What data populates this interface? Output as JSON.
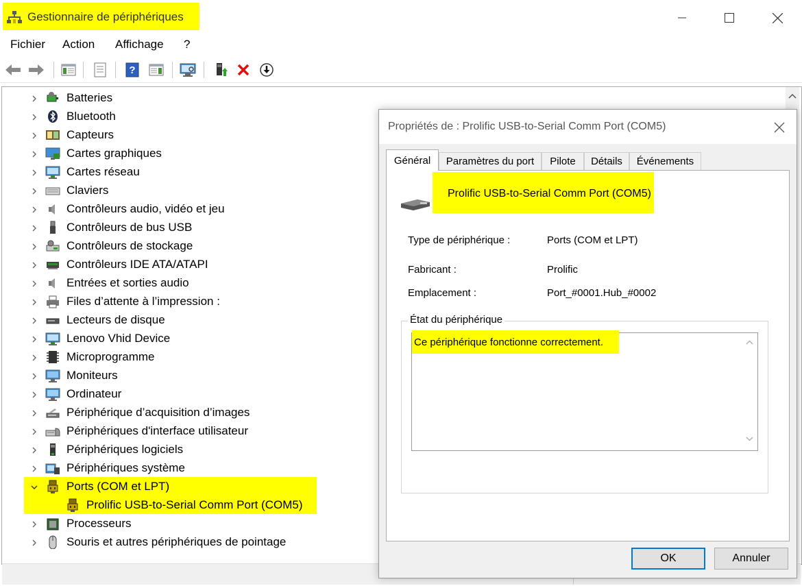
{
  "window": {
    "title": "Gestionnaire de périphériques",
    "controls": {
      "minimize": "—",
      "maximize": "☐",
      "close": "✕"
    }
  },
  "menu": [
    {
      "label": "Fichier"
    },
    {
      "label": "Action"
    },
    {
      "label": "Affichage"
    },
    {
      "label": "?"
    }
  ],
  "toolbar": {
    "icons": [
      "back-arrow-icon",
      "forward-arrow-icon",
      "show-hide-console-tree-icon",
      "properties-sheet-icon",
      "help-icon",
      "action-pane-icon",
      "scan-hardware-icon",
      "update-driver-icon",
      "uninstall-device-icon",
      "disable-device-icon"
    ]
  },
  "tree": {
    "categories": [
      {
        "label": "Batteries",
        "icon": "battery-icon",
        "expanded": false
      },
      {
        "label": "Bluetooth",
        "icon": "bluetooth-icon",
        "expanded": false
      },
      {
        "label": "Capteurs",
        "icon": "sensor-icon",
        "expanded": false
      },
      {
        "label": "Cartes graphiques",
        "icon": "display-adapter-icon",
        "expanded": false
      },
      {
        "label": "Cartes réseau",
        "icon": "network-adapter-icon",
        "expanded": false
      },
      {
        "label": "Claviers",
        "icon": "keyboard-icon",
        "expanded": false
      },
      {
        "label": "Contrôleurs audio, vidéo et jeu",
        "icon": "speaker-icon",
        "expanded": false
      },
      {
        "label": "Contrôleurs de bus USB",
        "icon": "usb-icon",
        "expanded": false
      },
      {
        "label": "Contrôleurs de stockage",
        "icon": "storage-controller-icon",
        "expanded": false
      },
      {
        "label": "Contrôleurs IDE ATA/ATAPI",
        "icon": "ide-controller-icon",
        "expanded": false
      },
      {
        "label": "Entrées et sorties audio",
        "icon": "speaker-icon",
        "expanded": false
      },
      {
        "label": "Files d’attente à l’impression :",
        "icon": "printer-icon",
        "expanded": false
      },
      {
        "label": "Lecteurs de disque",
        "icon": "disk-drive-icon",
        "expanded": false
      },
      {
        "label": "Lenovo Vhid Device",
        "icon": "network-monitor-icon",
        "expanded": false
      },
      {
        "label": "Microprogramme",
        "icon": "firmware-chip-icon",
        "expanded": false
      },
      {
        "label": "Moniteurs",
        "icon": "monitor-icon",
        "expanded": false
      },
      {
        "label": "Ordinateur",
        "icon": "computer-icon",
        "expanded": false
      },
      {
        "label": "Périphérique d’acquisition d’images",
        "icon": "scanner-icon",
        "expanded": false
      },
      {
        "label": "Périphériques d'interface utilisateur",
        "icon": "hid-icon",
        "expanded": false
      },
      {
        "label": "Périphériques logiciels",
        "icon": "software-device-icon",
        "expanded": false
      },
      {
        "label": "Périphériques système",
        "icon": "system-device-icon",
        "expanded": false
      },
      {
        "label": "Ports (COM et LPT)",
        "icon": "port-icon",
        "expanded": true,
        "children": [
          {
            "label": "Prolific USB-to-Serial Comm Port (COM5)",
            "icon": "port-icon"
          }
        ]
      },
      {
        "label": "Processeurs",
        "icon": "processor-icon",
        "expanded": false
      },
      {
        "label": "Souris et autres périphériques de pointage",
        "icon": "mouse-icon",
        "expanded": false
      }
    ]
  },
  "dialog": {
    "title": "Propriétés de : Prolific USB-to-Serial Comm Port (COM5)",
    "tabs": [
      "Général",
      "Paramètres du port",
      "Pilote",
      "Détails",
      "Événements"
    ],
    "active_tab": "Général",
    "device_name": "Prolific USB-to-Serial Comm Port (COM5)",
    "properties": [
      {
        "label": "Type de périphérique :",
        "value": "Ports (COM et LPT)"
      },
      {
        "label": "Fabricant :",
        "value": "Prolific"
      },
      {
        "label": "Emplacement :",
        "value": "Port_#0001.Hub_#0002"
      }
    ],
    "status_legend": "État du périphérique",
    "status_text": "Ce périphérique fonctionne correctement.",
    "ok_label": "OK",
    "cancel_label": "Annuler"
  },
  "colors": {
    "highlight": "#ffff00",
    "accent": "#0078d7"
  }
}
